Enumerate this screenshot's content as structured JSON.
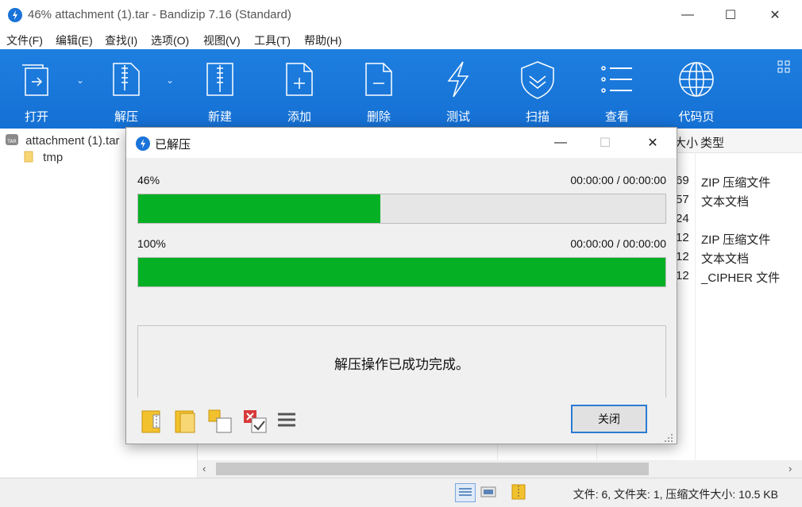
{
  "window": {
    "title": "46% attachment (1).tar - Bandizip 7.16 (Standard)",
    "minimize_glyph": "—",
    "maximize_glyph": "☐",
    "close_glyph": "✕"
  },
  "menu": [
    "文件(F)",
    "编辑(E)",
    "查找(I)",
    "选项(O)",
    "视图(V)",
    "工具(T)",
    "帮助(H)"
  ],
  "toolbar": {
    "buttons": [
      {
        "label": "打开",
        "icon": "open-icon"
      },
      {
        "label": "解压",
        "icon": "extract-icon"
      },
      {
        "label": "新建",
        "icon": "new-archive-icon"
      },
      {
        "label": "添加",
        "icon": "add-file-icon"
      },
      {
        "label": "删除",
        "icon": "delete-file-icon"
      },
      {
        "label": "测试",
        "icon": "test-icon"
      },
      {
        "label": "扫描",
        "icon": "scan-shield-icon"
      },
      {
        "label": "查看",
        "icon": "view-list-icon"
      },
      {
        "label": "代码页",
        "icon": "globe-icon"
      }
    ],
    "dropdown_glyph": "⌄"
  },
  "tree": {
    "root": "attachment (1).tar",
    "child": "tmp"
  },
  "list": {
    "headers": {
      "size": "大小",
      "type": "类型"
    },
    "rows": [
      {
        "size_tail": "69",
        "type": "ZIP 压缩文件"
      },
      {
        "size_tail": "57",
        "type": "文本文档"
      },
      {
        "size_tail": "24",
        "type": ""
      },
      {
        "size_tail": "12",
        "type": "ZIP 压缩文件"
      },
      {
        "size_tail": "12",
        "type": "文本文档"
      },
      {
        "size_tail": "12",
        "type": "_CIPHER 文件"
      }
    ]
  },
  "status": {
    "text": "文件: 6, 文件夹: 1, 压缩文件大小: 10.5 KB"
  },
  "dialog": {
    "title": "已解压",
    "progress": [
      {
        "percent_label": "46%",
        "value": 0.46,
        "time": "00:00:00 / 00:00:00"
      },
      {
        "percent_label": "100%",
        "value": 1.0,
        "time": "00:00:00 / 00:00:00"
      }
    ],
    "message": "解压操作已成功完成。",
    "close_label": "关闭",
    "bar_color": "#06b025"
  },
  "colors": {
    "toolbar_blue": "#1e7fe0",
    "accent": "#1a73d9"
  }
}
